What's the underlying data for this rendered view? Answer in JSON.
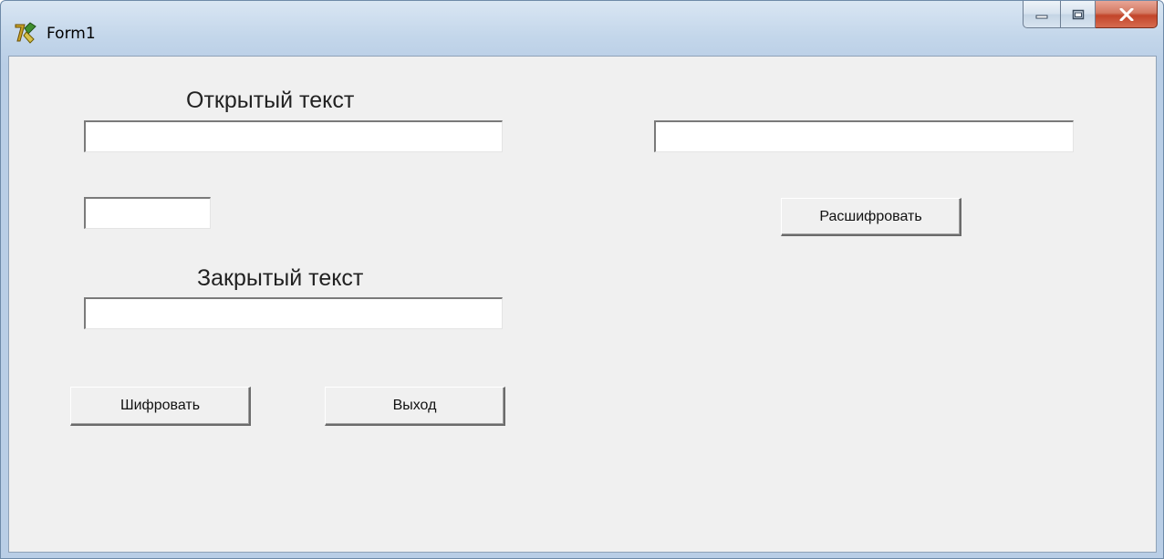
{
  "window": {
    "title": "Form1",
    "title_color": "#000000",
    "close_color": "#c2452a"
  },
  "labels": {
    "plain_text": "Открытый текст",
    "cipher_text": "Закрытый текст"
  },
  "inputs": {
    "plain_text": {
      "value": "",
      "placeholder": ""
    },
    "key": {
      "value": "",
      "placeholder": ""
    },
    "cipher_text": {
      "value": "",
      "placeholder": ""
    },
    "decrypted_text": {
      "value": "",
      "placeholder": ""
    }
  },
  "buttons": {
    "encrypt": "Шифровать",
    "exit": "Выход",
    "decrypt": "Расшифровать"
  },
  "icons": {
    "app": "delphi-app-icon",
    "minimize": "minimize-icon",
    "maximize": "maximize-icon",
    "close": "close-icon"
  }
}
